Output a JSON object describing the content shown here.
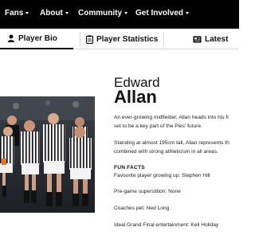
{
  "topnav": {
    "items": [
      {
        "label": "Fans",
        "has_menu": true
      },
      {
        "label": "About",
        "has_menu": true
      },
      {
        "label": "Community",
        "has_menu": true
      },
      {
        "label": "Get Involved",
        "has_menu": true
      }
    ]
  },
  "tabs": [
    {
      "label": "Player Bio",
      "icon": "person-icon",
      "active": true
    },
    {
      "label": "Player Statistics",
      "icon": "clipboard-icon",
      "active": false
    },
    {
      "label": "Latest",
      "icon": "news-icon",
      "active": false
    }
  ],
  "player": {
    "first_name": "Edward",
    "last_name": "Allan"
  },
  "bio": {
    "p1_line1": "An ever-growing midfielder, Allan heads into his fi",
    "p1_line2": "set to be a key part of the Pies' future.",
    "p2_line1": "Standing at almost 195cm tall, Allan represents th",
    "p2_line2": "combined with strong athleticism in all areas."
  },
  "fun_facts": {
    "heading": "FUN FACTS",
    "items": [
      "Favourite player growing up: Stephen Hill",
      "Pre-game superstition: None",
      "Coaches pet: Ned Long",
      "Ideal Grand Final entertainment: Keli Holiday"
    ]
  },
  "colors": {
    "nav_bg": "#000000",
    "nav_text": "#ffffff",
    "jersey_black": "#0d0d0d",
    "jersey_white": "#f2f2f2"
  }
}
